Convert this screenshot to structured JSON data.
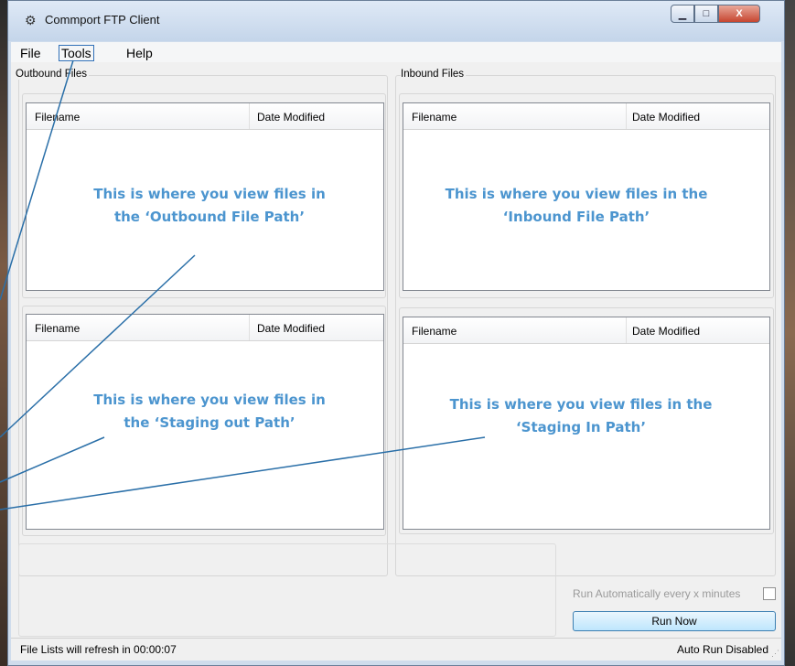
{
  "window": {
    "title": "Commport FTP Client",
    "controls": {
      "minimize": "▁",
      "maximize": "□",
      "close": "X"
    }
  },
  "menu": {
    "file": "File",
    "tools": "Tools",
    "help": "Help"
  },
  "groups": {
    "outbound": "Outbound Files",
    "inbound": "Inbound Files"
  },
  "columns": {
    "filename": "Filename",
    "date_modified": "Date Modified"
  },
  "annotations": {
    "outbound_1": "This is where you view files in",
    "outbound_2": "the ‘Outbound File Path’",
    "inbound_1": "This is where you view files in the",
    "inbound_2": "‘Inbound File Path’",
    "staging_out_1": "This is where you view files in",
    "staging_out_2": "the ‘Staging out Path’",
    "staging_in_1": "This is where you view files in the",
    "staging_in_2": "‘Staging In Path’"
  },
  "auto_run": {
    "label": "Run Automatically every x minutes",
    "checked": false
  },
  "run_now": "Run Now",
  "status": {
    "refresh": "File Lists will refresh in 00:00:07",
    "auto_run_state": "Auto Run Disabled"
  },
  "colors": {
    "annotation": "#4c95cf",
    "callout_line": "#2a6fa8",
    "highlight": "#2f6fb7"
  }
}
